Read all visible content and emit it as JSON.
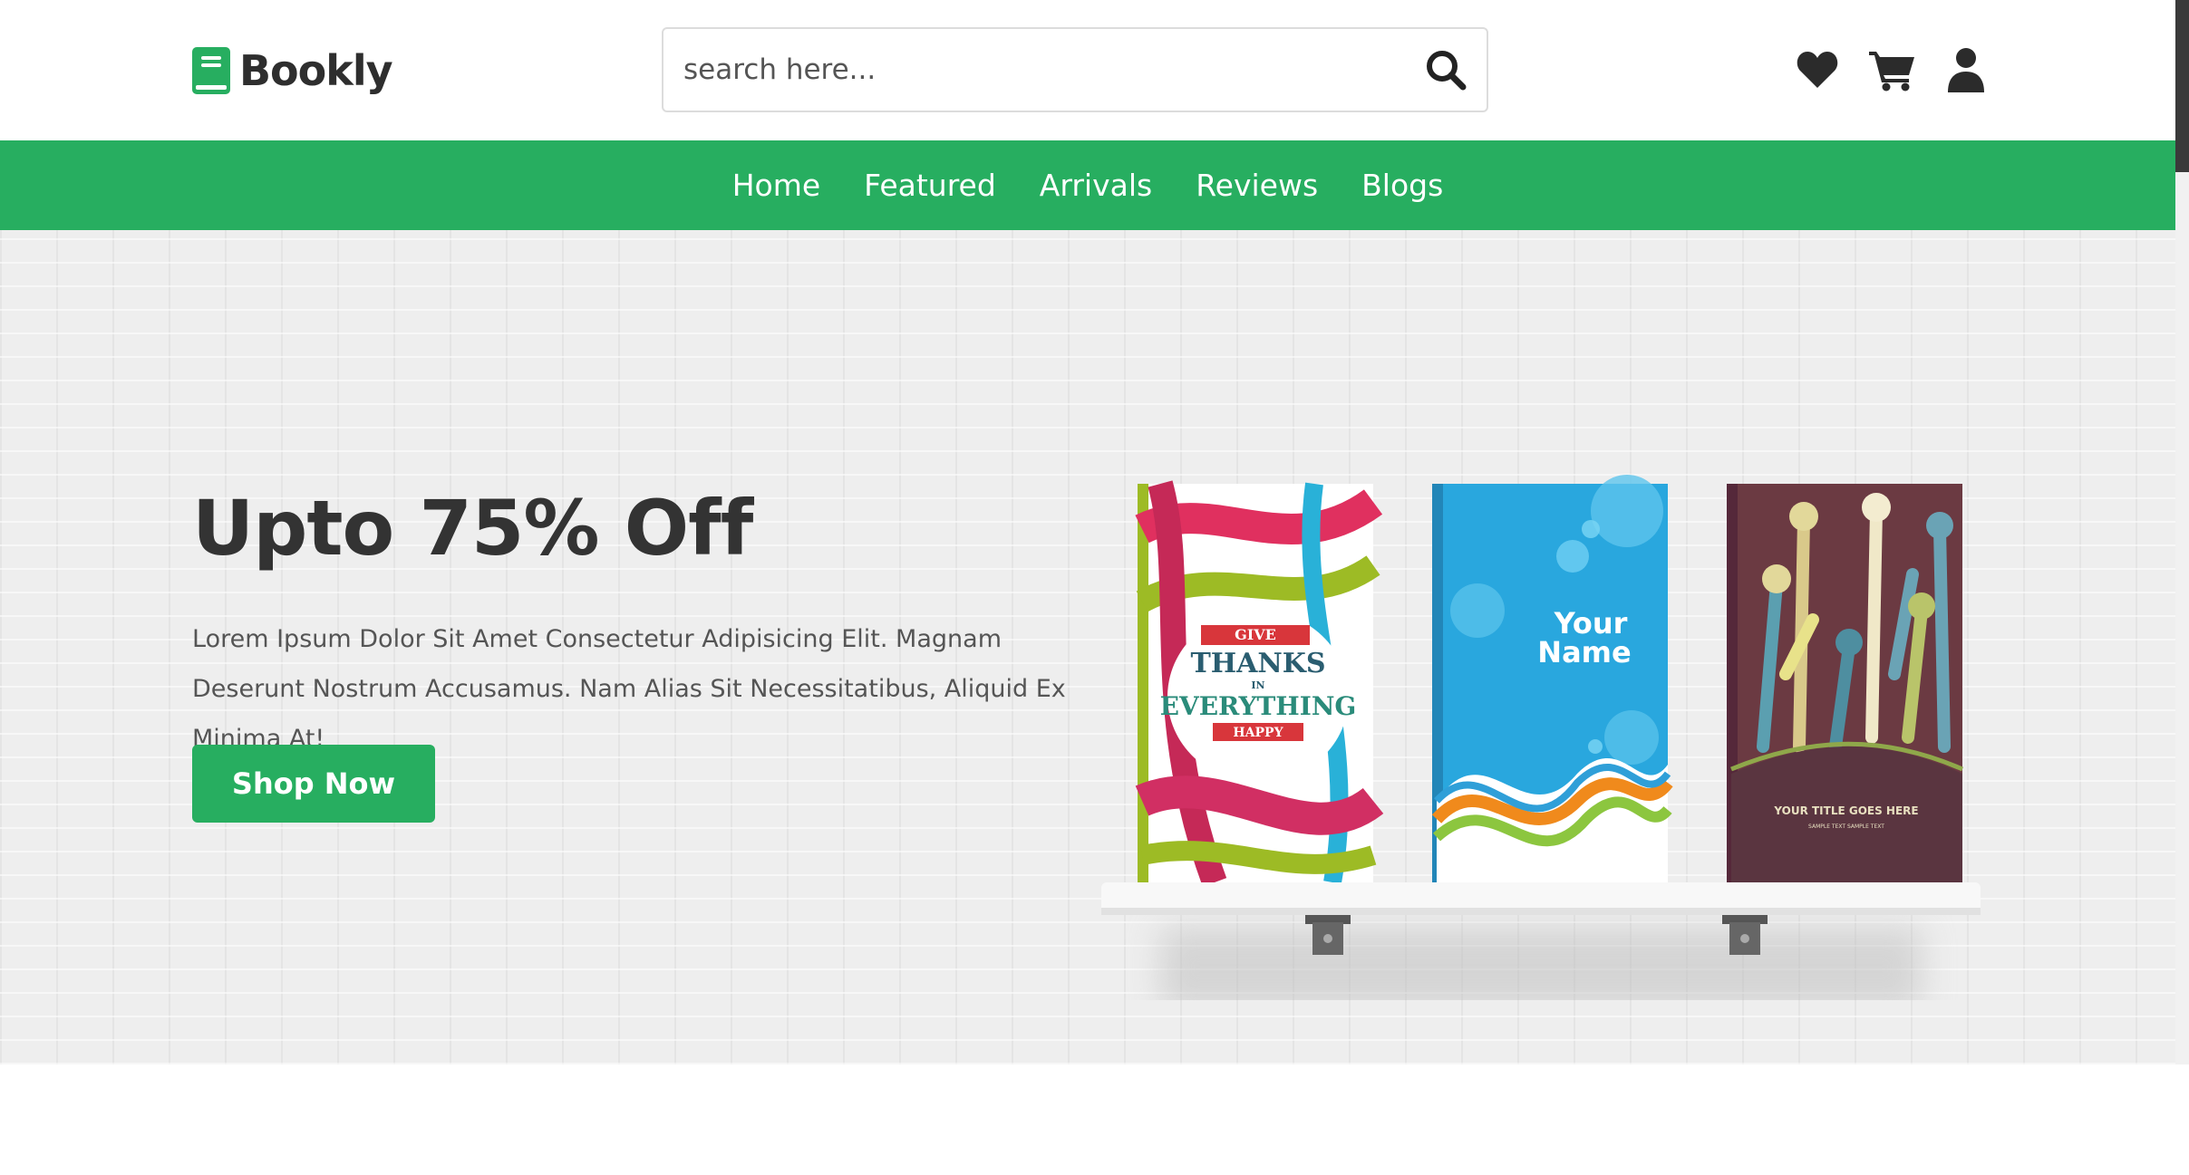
{
  "header": {
    "logo_text": "Bookly",
    "search_placeholder": "search here...",
    "icons": [
      "heart-icon",
      "cart-icon",
      "user-icon"
    ]
  },
  "nav": {
    "items": [
      "Home",
      "Featured",
      "Arrivals",
      "Reviews",
      "Blogs"
    ]
  },
  "hero": {
    "title": "Upto 75% Off",
    "text": "Lorem Ipsum Dolor Sit Amet Consectetur Adipisicing Elit. Magnam Deserunt Nostrum Accusamus. Nam Alias Sit Necessitatibus, Aliquid Ex Minima At!",
    "button_label": "Shop Now",
    "books": [
      {
        "lines": [
          "GIVE",
          "THANKS",
          "IN",
          "EVERYTHING",
          "HAPPY"
        ]
      },
      {
        "lines": [
          "Your",
          "Name"
        ]
      },
      {
        "lines": [
          "YOUR TITLE GOES HERE",
          "SAMPLE TEXT SAMPLE TEXT"
        ]
      }
    ]
  },
  "colors": {
    "brand_green": "#27ae60",
    "text_dark": "#333333",
    "hero_bg": "#eeeeee"
  }
}
